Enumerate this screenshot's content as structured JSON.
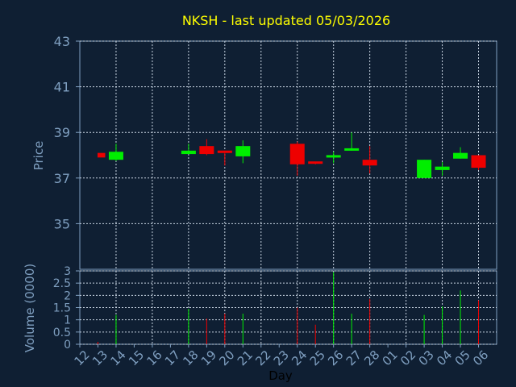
{
  "chart_data": {
    "type": "candlestick",
    "title": "NKSH - last updated 05/03/2026",
    "price_label": "Price",
    "volume_label": "Volume (0000)",
    "xlabel": "Day",
    "price_ticks": [
      43,
      41,
      39,
      37,
      35
    ],
    "price_ylim": [
      33,
      43
    ],
    "volume_ticks": [
      "3",
      "2.5",
      "2",
      "1.5",
      "1",
      "0.5",
      "0"
    ],
    "volume_ylim": [
      0,
      3
    ],
    "x_labels": [
      "12",
      "13",
      "14",
      "15",
      "16",
      "17",
      "18",
      "19",
      "20",
      "21",
      "22",
      "23",
      "24",
      "25",
      "26",
      "27",
      "28",
      "01",
      "02",
      "03",
      "04",
      "05",
      "06"
    ],
    "candles": [
      {
        "x": 0,
        "open": 38.1,
        "close": 37.9,
        "high": 38.1,
        "low": 37.9,
        "volume": 0.1
      },
      {
        "x": 1,
        "open": 37.8,
        "close": 38.15,
        "high": 38.5,
        "low": 37.75,
        "volume": 1.2
      },
      {
        "x": 5,
        "open": 38.05,
        "close": 38.2,
        "high": 38.5,
        "low": 38.05,
        "volume": 1.45
      },
      {
        "x": 6,
        "open": 38.4,
        "close": 38.05,
        "high": 38.7,
        "low": 38.0,
        "volume": 1.05
      },
      {
        "x": 7,
        "open": 38.2,
        "close": 38.1,
        "high": 38.2,
        "low": 37.55,
        "volume": 1.25
      },
      {
        "x": 8,
        "open": 37.95,
        "close": 38.4,
        "high": 38.65,
        "low": 37.65,
        "volume": 1.25
      },
      {
        "x": 11,
        "open": 38.5,
        "close": 37.6,
        "high": 38.6,
        "low": 37.1,
        "volume": 1.5
      },
      {
        "x": 12,
        "open": 37.7,
        "close": 37.65,
        "high": 37.7,
        "low": 37.6,
        "volume": 0.8
      },
      {
        "x": 13,
        "open": 37.9,
        "close": 38.0,
        "high": 38.15,
        "low": 37.65,
        "volume": 2.95
      },
      {
        "x": 14,
        "open": 38.2,
        "close": 38.3,
        "high": 39.0,
        "low": 38.2,
        "volume": 1.25
      },
      {
        "x": 15,
        "open": 37.8,
        "close": 37.55,
        "high": 38.4,
        "low": 37.2,
        "volume": 1.85
      },
      {
        "x": 18,
        "open": 37.0,
        "close": 37.8,
        "high": 37.8,
        "low": 37.0,
        "volume": 1.2
      },
      {
        "x": 19,
        "open": 37.35,
        "close": 37.5,
        "high": 37.7,
        "low": 37.1,
        "volume": 1.55
      },
      {
        "x": 20,
        "open": 37.85,
        "close": 38.1,
        "high": 38.35,
        "low": 37.85,
        "volume": 2.2
      },
      {
        "x": 21,
        "open": 38.0,
        "close": 37.45,
        "high": 38.0,
        "low": 37.35,
        "volume": 1.8
      }
    ]
  },
  "colors": {
    "background": "#0f1f33",
    "up": "#00ee00",
    "down": "#ee0000",
    "grid": "#c8d4e2",
    "axis": "#7f9fc0",
    "title": "#ffff00"
  }
}
